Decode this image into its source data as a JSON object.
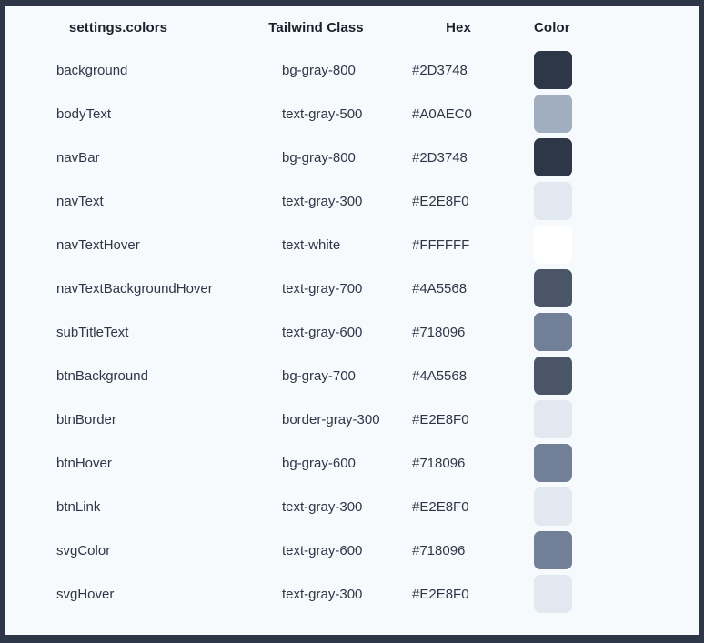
{
  "frame": {
    "border_color": "#2D3748",
    "card_background": "#F7FAFC"
  },
  "table": {
    "headers": {
      "name": "settings.colors",
      "tailwind_class": "Tailwind Class",
      "hex": "Hex",
      "color": "Color"
    },
    "rows": [
      {
        "name": "background",
        "tailwind_class": "bg-gray-800",
        "hex": "#2D3748"
      },
      {
        "name": "bodyText",
        "tailwind_class": "text-gray-500",
        "hex": "#A0AEC0"
      },
      {
        "name": "navBar",
        "tailwind_class": "bg-gray-800",
        "hex": "#2D3748"
      },
      {
        "name": "navText",
        "tailwind_class": "text-gray-300",
        "hex": "#E2E8F0"
      },
      {
        "name": "navTextHover",
        "tailwind_class": "text-white",
        "hex": "#FFFFFF"
      },
      {
        "name": "navTextBackgroundHover",
        "tailwind_class": "text-gray-700",
        "hex": "#4A5568"
      },
      {
        "name": "subTitleText",
        "tailwind_class": "text-gray-600",
        "hex": "#718096"
      },
      {
        "name": "btnBackground",
        "tailwind_class": "bg-gray-700",
        "hex": "#4A5568"
      },
      {
        "name": "btnBorder",
        "tailwind_class": "border-gray-300",
        "hex": "#E2E8F0"
      },
      {
        "name": "btnHover",
        "tailwind_class": "bg-gray-600",
        "hex": "#718096"
      },
      {
        "name": "btnLink",
        "tailwind_class": "text-gray-300",
        "hex": "#E2E8F0"
      },
      {
        "name": "svgColor",
        "tailwind_class": "text-gray-600",
        "hex": "#718096"
      },
      {
        "name": "svgHover",
        "tailwind_class": "text-gray-300",
        "hex": "#E2E8F0"
      }
    ]
  }
}
